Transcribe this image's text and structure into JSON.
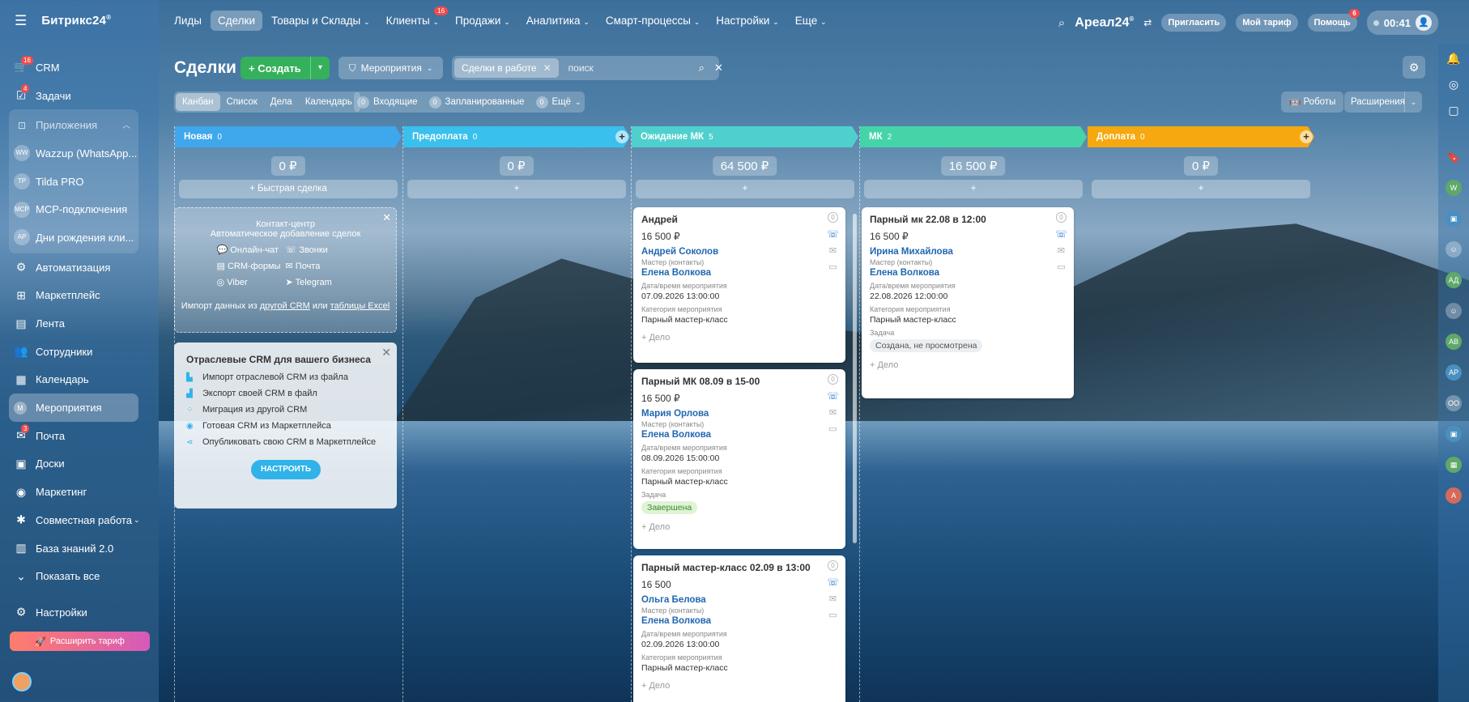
{
  "app": {
    "logo": "Битрикс24",
    "logo_mark": "®",
    "brand": "Ареал24",
    "brand_mark": "®"
  },
  "sidebar": {
    "items": [
      {
        "icon": "cart-icon",
        "glyph": "🛒",
        "label": "CRM",
        "badge": "16"
      },
      {
        "icon": "tasks-icon",
        "glyph": "☑",
        "label": "Задачи",
        "badge": "4"
      }
    ],
    "apps_header": "Приложения",
    "apps": [
      {
        "abbr": "WW",
        "label": "Wazzup (WhatsApp..."
      },
      {
        "abbr": "TP",
        "label": "Tilda PRO"
      },
      {
        "abbr": "MCP",
        "label": "MCP-подключения"
      },
      {
        "abbr": "AP",
        "label": "Дни рождения кли..."
      }
    ],
    "items2": [
      {
        "icon": "automation-icon",
        "glyph": "⚙",
        "label": "Автоматизация"
      },
      {
        "icon": "market-icon",
        "glyph": "⊞",
        "label": "Маркетплейс"
      },
      {
        "icon": "feed-icon",
        "glyph": "▤",
        "label": "Лента"
      },
      {
        "icon": "employees-icon",
        "glyph": "👥",
        "label": "Сотрудники"
      },
      {
        "icon": "calendar-icon",
        "glyph": "▦",
        "label": "Календарь"
      }
    ],
    "active_item": {
      "abbr": "M",
      "label": "Мероприятия"
    },
    "items3": [
      {
        "icon": "mail-icon",
        "glyph": "✉",
        "label": "Почта",
        "badge": "3"
      },
      {
        "icon": "boards-icon",
        "glyph": "▣",
        "label": "Доски"
      },
      {
        "icon": "marketing-icon",
        "glyph": "◉",
        "label": "Маркетинг"
      },
      {
        "icon": "collab-icon",
        "glyph": "✱",
        "label": "Совместная работа"
      },
      {
        "icon": "knowledge-icon",
        "glyph": "▥",
        "label": "База знаний 2.0"
      }
    ],
    "show_all": "Показать все",
    "settings": "Настройки",
    "upgrade": "Расширить тариф"
  },
  "topnav": {
    "items": [
      {
        "label": "Лиды"
      },
      {
        "label": "Сделки",
        "active": true
      },
      {
        "label": "Товары и Склады",
        "dd": "⌄"
      },
      {
        "label": "Клиенты",
        "dd": "⌄",
        "badge": "16"
      },
      {
        "label": "Продажи",
        "dd": "⌄"
      },
      {
        "label": "Аналитика",
        "dd": "⌄"
      },
      {
        "label": "Смарт-процессы",
        "dd": "⌄"
      },
      {
        "label": "Настройки",
        "dd": "⌄"
      },
      {
        "label": "Еще",
        "dd": "⌄"
      }
    ],
    "invite": "Пригласить",
    "tariff": "Мой тариф",
    "help": "Помощь",
    "help_badge": "6",
    "time": "00:41"
  },
  "page": {
    "title": "Сделки",
    "create": "Создать",
    "category": "Мероприятия",
    "filter_chip": "Сделки в работе",
    "search_placeholder": "поиск"
  },
  "views": [
    "Канбан",
    "Список",
    "Дела",
    "Календарь"
  ],
  "filters": [
    {
      "count": "0",
      "label": "Входящие"
    },
    {
      "count": "0",
      "label": "Запланированные"
    },
    {
      "count": "0",
      "label": "Ещё"
    }
  ],
  "robots": "Роботы",
  "extensions": "Расширения",
  "columns": [
    {
      "name": "Новая",
      "count": "0",
      "sum": "0 ₽",
      "add": "+ Быстрая сделка",
      "color": "#3fa7ec"
    },
    {
      "name": "Предоплата",
      "count": "0",
      "sum": "0 ₽",
      "add": "+",
      "color": "#3ac0ec"
    },
    {
      "name": "Ожидание МК",
      "count": "5",
      "sum": "64 500 ₽",
      "add": "+",
      "color": "#4fd0cf"
    },
    {
      "name": "МК",
      "count": "2",
      "sum": "16 500 ₽",
      "add": "+",
      "color": "#45d4a8"
    },
    {
      "name": "Доплата",
      "count": "0",
      "sum": "0 ₽",
      "add": "+",
      "color": "#f5a80f"
    }
  ],
  "contact_center": {
    "title": "Контакт-центр",
    "subtitle": "Автоматическое добавление сделок",
    "channels": [
      "Онлайн-чат",
      "Звонки",
      "CRM-формы",
      "Почта",
      "Viber",
      "Telegram"
    ],
    "import_prefix": "Импорт данных из",
    "import_link1": "другой CRM",
    "import_mid": "или",
    "import_link2": "таблицы Excel"
  },
  "industry": {
    "title": "Отраслевые CRM для вашего бизнеса",
    "items": [
      "Импорт отраслевой CRM из файла",
      "Экспорт своей CRM в файл",
      "Миграция из другой CRM",
      "Готовая CRM из Маркетплейса",
      "Опубликовать свою CRM в Маркетплейсе"
    ],
    "button": "НАСТРОИТЬ"
  },
  "labels": {
    "master": "Мастер (контакты)",
    "datetime": "Дата/время мероприятия",
    "category": "Категория мероприятия",
    "task": "Задача",
    "deal": "+ Дело"
  },
  "cards_wait": [
    {
      "title": "Андрей",
      "sum": "16 500 ₽",
      "client": "Андрей Соколов",
      "master": "Елена Волкова",
      "date": "07.09.2026 13:00:00",
      "cat": "Парный мастер-класс",
      "task": ""
    },
    {
      "title": "Парный МК 08.09 в 15-00",
      "sum": "16 500 ₽",
      "client": "Мария Орлова",
      "master": "Елена Волкова",
      "date": "08.09.2026 15:00:00",
      "cat": "Парный мастер-класс",
      "task": "Завершена"
    },
    {
      "title": "Парный мастер-класс  02.09 в 13:00",
      "sum": "16 500",
      "client": "Ольга Белова",
      "master": "Елена Волкова",
      "date": "02.09.2026 13:00:00",
      "cat": "Парный мастер-класс",
      "task": ""
    }
  ],
  "cards_mk": [
    {
      "title": "Парный мк 22.08 в 12:00",
      "sum": "16 500 ₽",
      "client": "Ирина Михайлова",
      "master": "Елена Волкова",
      "date": "22.08.2026 12:00:00",
      "cat": "Парный мастер-класс",
      "task": "Создана, не просмотрена"
    }
  ],
  "rail": [
    "W",
    "АД",
    "АВ",
    "АР",
    "ОО",
    "А"
  ]
}
